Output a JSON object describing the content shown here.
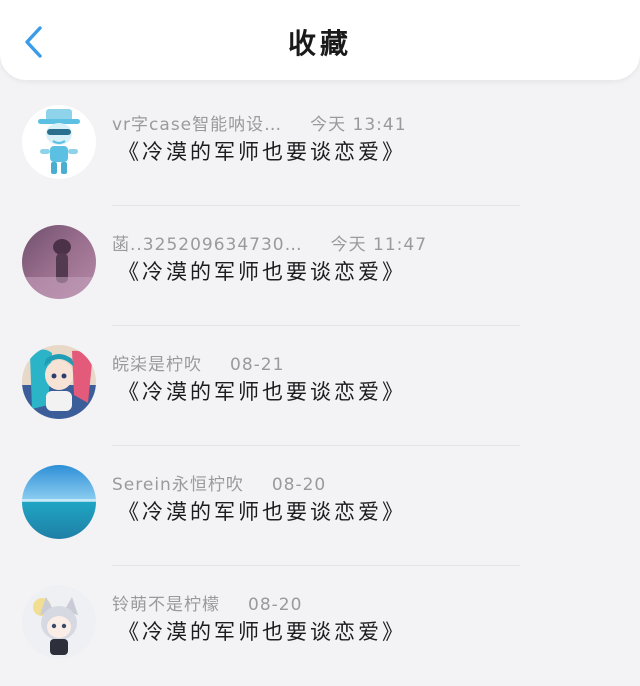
{
  "header": {
    "title": "收藏",
    "back_icon": "chevron-left-icon",
    "accent": "#3a9be8"
  },
  "items": [
    {
      "user": "vr字case智能呐设…",
      "time": "今天 13:41",
      "work": "《冷漠的军师也要谈恋爱》",
      "avatar": "cartoon-boy-avatar"
    },
    {
      "user": "菡..325209634730…",
      "time": "今天 11:47",
      "work": "《冷漠的军师也要谈恋爱》",
      "avatar": "purple-photo-avatar"
    },
    {
      "user": "皖柒是柠吹",
      "time": "08-21",
      "work": "《冷漠的军师也要谈恋爱》",
      "avatar": "anime-girl-avatar"
    },
    {
      "user": "Serein永恒柠吹",
      "time": "08-20",
      "work": "《冷漠的军师也要谈恋爱》",
      "avatar": "ocean-avatar"
    },
    {
      "user": "铃萌不是柠檬",
      "time": "08-20",
      "work": "《冷漠的军师也要谈恋爱》",
      "avatar": "anime-cat-girl-avatar"
    }
  ]
}
